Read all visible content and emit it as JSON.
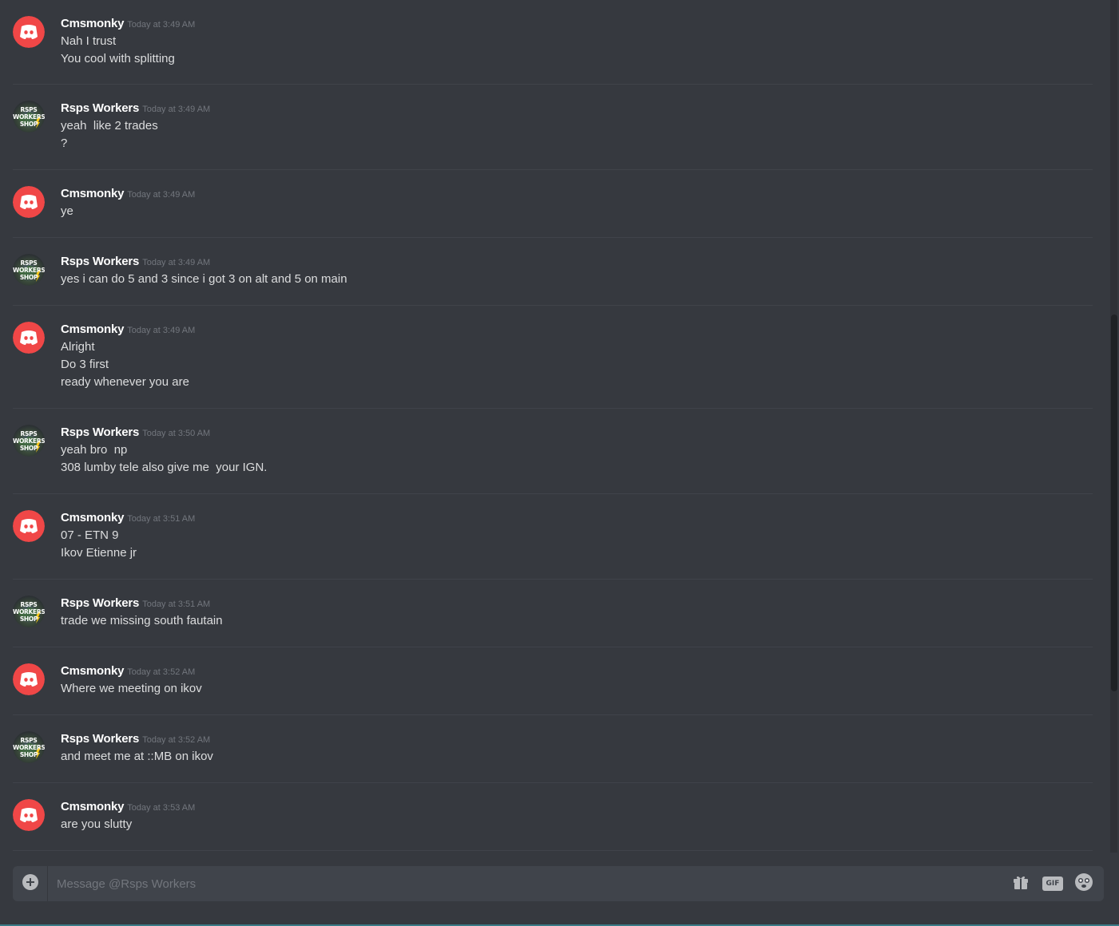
{
  "users": {
    "cmsmonky": {
      "name": "Cmsmonky",
      "avatar": "discord-logo-icon",
      "avatar_color": "#f04747"
    },
    "rsps": {
      "name": "Rsps Workers",
      "avatar": "rsps-workers-shop-logo",
      "avatar_text_1": "RSPS",
      "avatar_text_2": "WORKERS",
      "avatar_text_3": "SHOP"
    }
  },
  "messages": [
    {
      "author": "Cmsmonky",
      "avatar": "discord",
      "time": "Today at 3:49 AM",
      "lines": [
        "Nah I trust",
        "You cool with splitting"
      ]
    },
    {
      "author": "Rsps Workers",
      "avatar": "rsps",
      "time": "Today at 3:49 AM",
      "lines": [
        "yeah  like 2 trades",
        "?"
      ]
    },
    {
      "author": "Cmsmonky",
      "avatar": "discord",
      "time": "Today at 3:49 AM",
      "lines": [
        "ye"
      ]
    },
    {
      "author": "Rsps Workers",
      "avatar": "rsps",
      "time": "Today at 3:49 AM",
      "lines": [
        "yes i can do 5 and 3 since i got 3 on alt and 5 on main"
      ]
    },
    {
      "author": "Cmsmonky",
      "avatar": "discord",
      "time": "Today at 3:49 AM",
      "lines": [
        "Alright",
        "Do 3 first",
        "ready whenever you are"
      ]
    },
    {
      "author": "Rsps Workers",
      "avatar": "rsps",
      "time": "Today at 3:50 AM",
      "lines": [
        "yeah bro  np",
        "308 lumby tele also give me  your IGN."
      ]
    },
    {
      "author": "Cmsmonky",
      "avatar": "discord",
      "time": "Today at 3:51 AM",
      "lines": [
        "07 - ETN 9",
        "Ikov Etienne jr"
      ]
    },
    {
      "author": "Rsps Workers",
      "avatar": "rsps",
      "time": "Today at 3:51 AM",
      "lines": [
        "trade we missing south fautain"
      ]
    },
    {
      "author": "Cmsmonky",
      "avatar": "discord",
      "time": "Today at 3:52 AM",
      "lines": [
        "Where we meeting on ikov"
      ]
    },
    {
      "author": "Rsps Workers",
      "avatar": "rsps",
      "time": "Today at 3:52 AM",
      "lines": [
        "and meet me at ::MB on ikov"
      ]
    },
    {
      "author": "Cmsmonky",
      "avatar": "discord",
      "time": "Today at 3:53 AM",
      "lines": [
        "are you slutty"
      ]
    }
  ],
  "composer": {
    "placeholder": "Message @Rsps Workers",
    "add_icon": "plus-circle-icon",
    "gift_icon": "gift-icon",
    "gif_label": "GIF",
    "emoji_icon": "emoji-icon"
  },
  "colors": {
    "background": "#36393f",
    "username": "#ffffff",
    "message_text": "#dcddde",
    "timestamp": "#72767d",
    "composer_bg": "#40444b"
  }
}
